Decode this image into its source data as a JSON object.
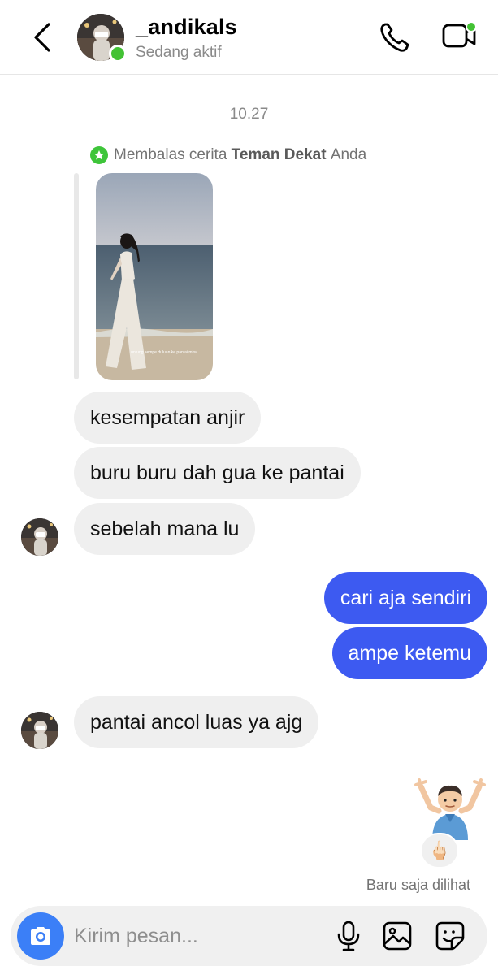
{
  "header": {
    "username": "_andikals",
    "status": "Sedang aktif",
    "icons": [
      "back-chevron-icon",
      "phone-icon",
      "video-camera-icon"
    ]
  },
  "thread": {
    "timestamp": "10.27",
    "reply_note": {
      "prefix": "Membalas cerita",
      "highlight": "Teman Dekat",
      "suffix": "Anda"
    },
    "story_caption": "untung sempe duluan ke pantai mkw",
    "messages": [
      {
        "from": "them",
        "text": "kesempatan anjir"
      },
      {
        "from": "them",
        "text": "buru buru dah gua ke pantai"
      },
      {
        "from": "them",
        "text": "sebelah mana lu"
      },
      {
        "from": "me",
        "text": "cari aja sendiri"
      },
      {
        "from": "me",
        "text": "ampe ketemu"
      },
      {
        "from": "them",
        "text": "pantai ancol luas ya ajg"
      }
    ],
    "reaction": {
      "emoji": "🤷🏻‍♂️",
      "reacted_with": "🖕🏻"
    },
    "seen_label": "Baru saja dilihat"
  },
  "composer": {
    "placeholder": "Kirim pesan...",
    "value": "",
    "icons": [
      "camera-icon",
      "microphone-icon",
      "gallery-icon",
      "sticker-icon"
    ]
  },
  "colors": {
    "outgoing_bubble": "#3d5af1",
    "incoming_bubble": "#efefef",
    "online_green": "#43c234",
    "camera_button": "#3b7ff7"
  }
}
